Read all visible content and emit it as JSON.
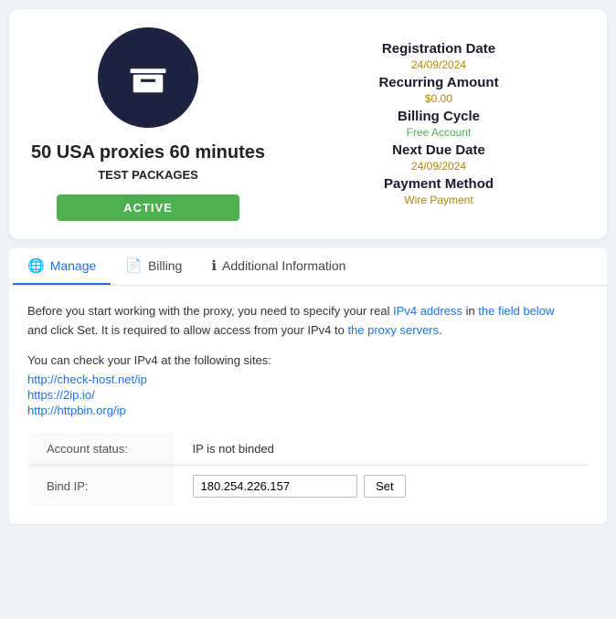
{
  "product_card": {
    "title": "50 USA proxies 60 minutes",
    "subtitle": "TEST PACKAGES",
    "status": "ACTIVE",
    "registration_date_label": "Registration Date",
    "registration_date_value": "24/09/2024",
    "recurring_amount_label": "Recurring Amount",
    "recurring_amount_value": "$0.00",
    "billing_cycle_label": "Billing Cycle",
    "billing_cycle_value": "Free Account",
    "next_due_date_label": "Next Due Date",
    "next_due_date_value": "24/09/2024",
    "payment_method_label": "Payment Method",
    "payment_method_value": "Wire Payment"
  },
  "tabs": [
    {
      "id": "manage",
      "label": "Manage",
      "icon": "🌐",
      "active": true
    },
    {
      "id": "billing",
      "label": "Billing",
      "icon": "📄",
      "active": false
    },
    {
      "id": "additional-info",
      "label": "Additional Information",
      "icon": "ℹ",
      "active": false
    }
  ],
  "manage_panel": {
    "intro_text_1": "Before you start working with the proxy, you need to specify your real IPv4 address in the field below and click Set. It is required to allow access from your IPv4 to the proxy servers.",
    "intro_text_2": "You can check your IPv4 at the following sites:",
    "links": [
      "http://check-host.net/ip",
      "https://2ip.io/",
      "http://httpbin.org/ip"
    ],
    "table": {
      "rows": [
        {
          "label": "Account status:",
          "value": "IP is not binded"
        },
        {
          "label": "Bind IP:",
          "value": "180.254.226.157"
        }
      ]
    },
    "set_button_label": "Set"
  }
}
